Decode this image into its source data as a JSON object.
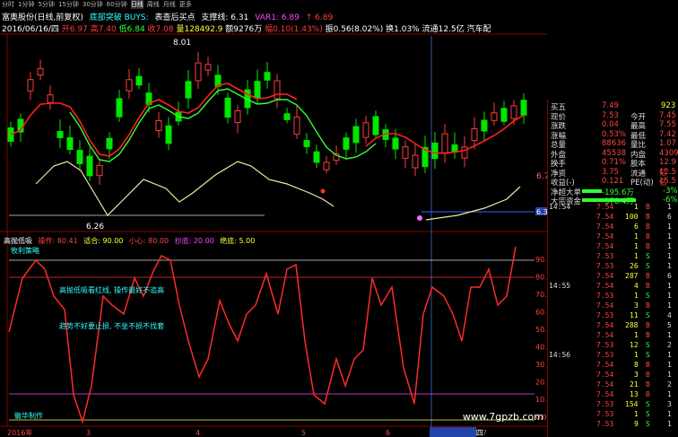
{
  "period_tabs": [
    "分时",
    "1分钟",
    "5分钟",
    "15分钟",
    "30分钟",
    "60分钟",
    "日线",
    "周线",
    "月线",
    "更多"
  ],
  "active_tab": "日线",
  "header": {
    "stock": "富奥股份(日线,前复权)",
    "indicator": "底部突破 BUYS:",
    "signal": "表查后买点",
    "support_label": "支撑线: 6.31",
    "var1": "VAR1: 6.89",
    "var_arrow": "↑ 6.89"
  },
  "info": {
    "date": "2016/06/16/四",
    "open": "开6.97",
    "high": "高7.40",
    "low": "低6.84",
    "close": "收7.08",
    "volume": "量128492.9",
    "amount": "额9276万",
    "change": "幅0.10(1.43%)",
    "amplitude": "振0.56(8.02%)",
    "turnover": "换1.03%",
    "float": "流通12.5亿",
    "sector": "汽车配"
  },
  "price_labels": {
    "high_mark": "8.01",
    "low_mark": "6.26",
    "right_level": "6.74",
    "right_level2": "6.39"
  },
  "sub_header": {
    "name": "高抛低吸",
    "p1": "操作: 80.41",
    "p2": "适合: 90.00",
    "p3": "小心: 80.00",
    "p4": "抄底: 20.00",
    "p5": "绝底: 5.00",
    "tag": "牧利策略"
  },
  "sub_axis": [
    "90.00",
    "80.00",
    "70.00",
    "60.00",
    "50.00",
    "40.00",
    "30.00",
    "20.00",
    "10.00",
    "0.00"
  ],
  "annotations": {
    "a1": "高抛低吸看红线, 操作最好不追高",
    "a2": "趋势不好要止损, 不坐不损不找套",
    "a3": "徽华制作"
  },
  "x_axis": [
    "2016年",
    "3",
    "4",
    "5",
    "6",
    "2016/06/16/四",
    "7"
  ],
  "quote": [
    {
      "label": "买五",
      "value": "7.49",
      "extra": "923"
    },
    {
      "label": "现价",
      "value": "7.53",
      "label2": "今开",
      "value2": "7.45"
    },
    {
      "label": "涨跌",
      "value": "0.04",
      "label2": "最高",
      "value2": "7.55"
    },
    {
      "label": "涨幅",
      "value": "0.53%",
      "label2": "最低",
      "value2": "7.42"
    },
    {
      "label": "总量",
      "value": "88636",
      "label2": "量比",
      "value2": "1.07"
    },
    {
      "label": "外盘",
      "value": "45538",
      "label2": "内盘",
      "value2": "43098"
    },
    {
      "label": "换手",
      "value": "0.71%",
      "label2": "股本",
      "value2": "12.9亿"
    },
    {
      "label": "净资",
      "value": "3.75",
      "label2": "流通",
      "value2": "12.5亿"
    },
    {
      "label": "收益(-)",
      "value": "0.121",
      "label2": "PE(动)",
      "value2": "15.5"
    },
    {
      "label": "净超大单",
      "value": "-195.6万",
      "pct": "-3%"
    },
    {
      "label": "大宗资金",
      "value": "-378.4万",
      "pct": "-6%"
    }
  ],
  "ticks": [
    {
      "time": "14:54",
      "price": "7.54",
      "vol": "1",
      "side": "B",
      "n": "1"
    },
    {
      "time": "",
      "price": "7.54",
      "vol": "100",
      "side": "B",
      "n": "6"
    },
    {
      "time": "",
      "price": "7.54",
      "vol": "6",
      "side": "B",
      "n": "1"
    },
    {
      "time": "",
      "price": "7.54",
      "vol": "1",
      "side": "B",
      "n": "1"
    },
    {
      "time": "",
      "price": "7.54",
      "vol": "1",
      "side": "B",
      "n": "1"
    },
    {
      "time": "",
      "price": "7.53",
      "vol": "1",
      "side": "S",
      "n": "1"
    },
    {
      "time": "",
      "price": "7.53",
      "vol": "26",
      "side": "S",
      "n": "1"
    },
    {
      "time": "",
      "price": "7.54",
      "vol": "287",
      "side": "B",
      "n": "6"
    },
    {
      "time": "14:55",
      "price": "7.54",
      "vol": "4",
      "side": "B",
      "n": "1"
    },
    {
      "time": "",
      "price": "7.53",
      "vol": "1",
      "side": "S",
      "n": "1"
    },
    {
      "time": "",
      "price": "7.54",
      "vol": "3",
      "side": "B",
      "n": "1"
    },
    {
      "time": "",
      "price": "7.53",
      "vol": "11",
      "side": "S",
      "n": "4"
    },
    {
      "time": "",
      "price": "7.54",
      "vol": "288",
      "side": "B",
      "n": "5"
    },
    {
      "time": "",
      "price": "7.54",
      "vol": "1",
      "side": "B",
      "n": "1"
    },
    {
      "time": "",
      "price": "7.53",
      "vol": "12",
      "side": "S",
      "n": "2"
    },
    {
      "time": "14:56",
      "price": "7.53",
      "vol": "1",
      "side": "S",
      "n": "1"
    },
    {
      "time": "",
      "price": "7.54",
      "vol": "8",
      "side": "B",
      "n": "1"
    },
    {
      "time": "",
      "price": "7.54",
      "vol": "3",
      "side": "B",
      "n": "1"
    },
    {
      "time": "",
      "price": "7.54",
      "vol": "21",
      "side": "B",
      "n": "2"
    },
    {
      "time": "",
      "price": "7.54",
      "vol": "13",
      "side": "B",
      "n": "1"
    },
    {
      "time": "",
      "price": "7.53",
      "vol": "154",
      "side": "S",
      "n": "3"
    },
    {
      "time": "",
      "price": "7.53",
      "vol": "1",
      "side": "S",
      "n": "1"
    },
    {
      "time": "",
      "price": "7.53",
      "vol": "9",
      "side": "S",
      "n": "1"
    }
  ],
  "watermark": "www.7gpzb.com",
  "colors": {
    "up": "#ff3b3b",
    "down": "#00e600",
    "ma": "#ff2020",
    "kdj": "#f5e8a0",
    "osc": "#ff2a2a"
  }
}
